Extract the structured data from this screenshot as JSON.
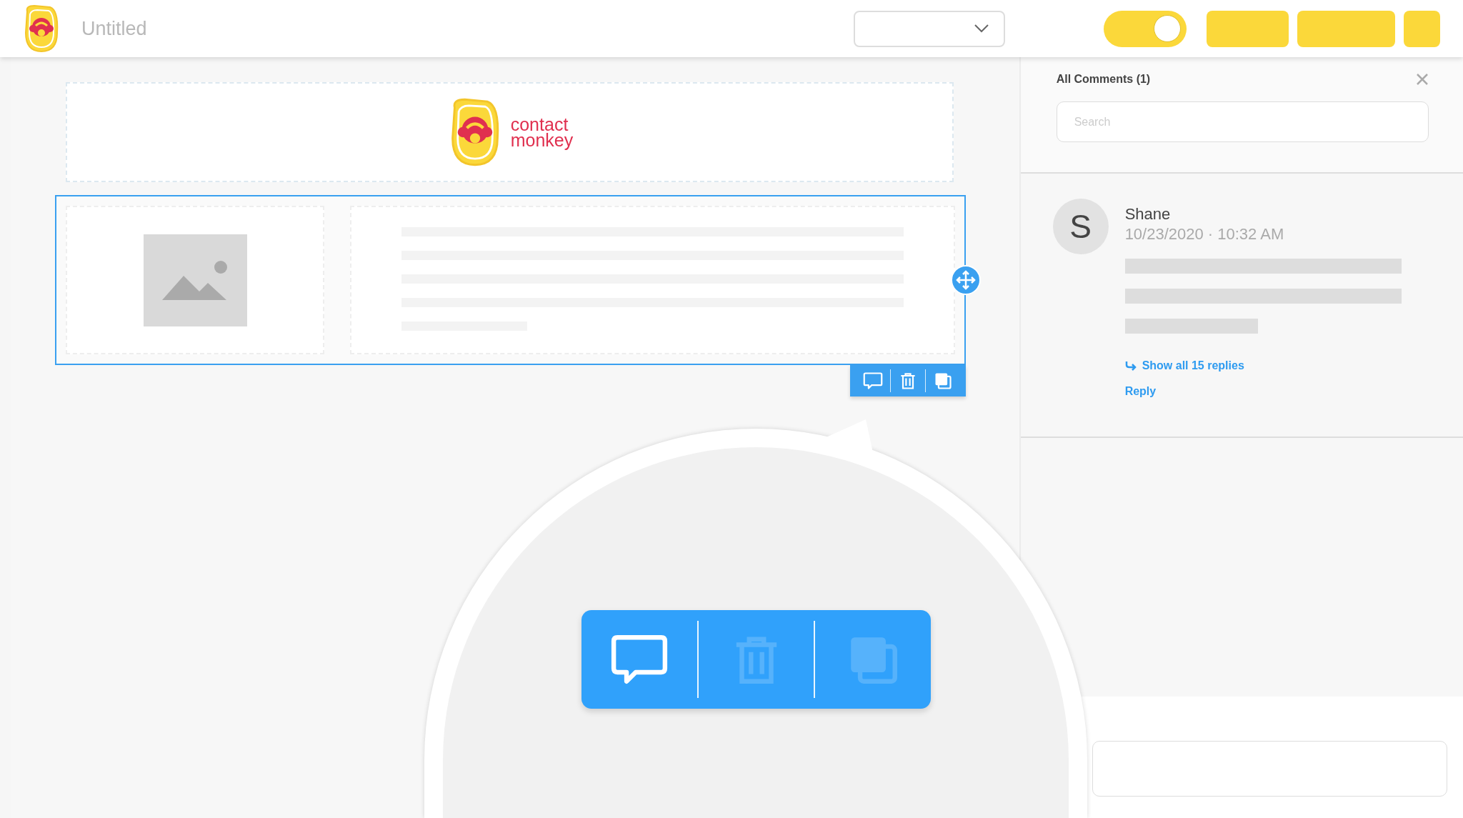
{
  "header": {
    "document_title": "Untitled",
    "toggle": {
      "on": true
    }
  },
  "canvas": {
    "logo_lines": [
      "contact",
      "monkey"
    ],
    "block_actions": [
      {
        "kind": "comment"
      },
      {
        "kind": "delete"
      },
      {
        "kind": "duplicate"
      }
    ]
  },
  "comments_panel": {
    "title": "All Comments (1)",
    "search": {
      "placeholder": "Search"
    },
    "comments": [
      {
        "avatar_initial": "S",
        "author": "Shane",
        "timestamp": "10/23/2020 · 10:32 AM",
        "replies_link": "Show all 15 replies",
        "reply_label": "Reply"
      }
    ]
  },
  "magnifier": {
    "actions": [
      {
        "kind": "comment",
        "active": true
      },
      {
        "kind": "delete",
        "active": false
      },
      {
        "kind": "duplicate",
        "active": false
      }
    ]
  }
}
